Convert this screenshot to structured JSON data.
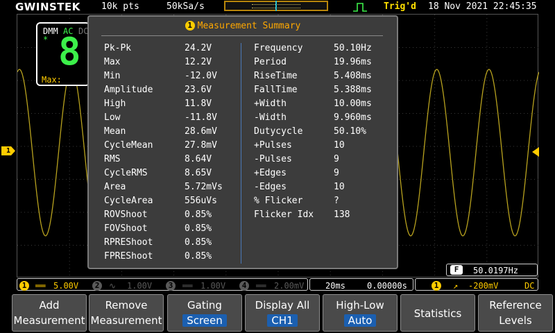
{
  "topbar": {
    "brand": "GWINSTEK",
    "memory_depth": "10k pts",
    "sample_rate": "50kSa/s",
    "trigger_status": "Trig'd",
    "datetime": "18 Nov 2021 22:45:35"
  },
  "dmm": {
    "label": "DMM",
    "mode": "AC",
    "mode_off": "DC",
    "marker": "*",
    "value": "8.",
    "max_label": "Max:",
    "max_value": "--"
  },
  "summary": {
    "title": "Measurement Summary",
    "channel": "1",
    "left": [
      {
        "name": "Pk-Pk",
        "value": "24.2V"
      },
      {
        "name": "Max",
        "value": "12.2V"
      },
      {
        "name": "Min",
        "value": "-12.0V"
      },
      {
        "name": "Amplitude",
        "value": "23.6V"
      },
      {
        "name": "High",
        "value": "11.8V"
      },
      {
        "name": "Low",
        "value": "-11.8V"
      },
      {
        "name": "Mean",
        "value": "28.6mV"
      },
      {
        "name": "CycleMean",
        "value": "27.8mV"
      },
      {
        "name": "RMS",
        "value": "8.64V"
      },
      {
        "name": "CycleRMS",
        "value": "8.65V"
      },
      {
        "name": "Area",
        "value": "5.72mVs"
      },
      {
        "name": "CycleArea",
        "value": "556uVs"
      },
      {
        "name": "ROVShoot",
        "value": "0.85%"
      },
      {
        "name": "FOVShoot",
        "value": "0.85%"
      },
      {
        "name": "RPREShoot",
        "value": "0.85%"
      },
      {
        "name": "FPREShoot",
        "value": "0.85%"
      }
    ],
    "right": [
      {
        "name": "Frequency",
        "value": "50.10Hz"
      },
      {
        "name": "Period",
        "value": "19.96ms"
      },
      {
        "name": "RiseTime",
        "value": "5.408ms"
      },
      {
        "name": "FallTime",
        "value": "5.388ms"
      },
      {
        "name": "+Width",
        "value": "10.00ms"
      },
      {
        "name": "-Width",
        "value": "9.960ms"
      },
      {
        "name": "Dutycycle",
        "value": "50.10%"
      },
      {
        "name": "+Pulses",
        "value": "10"
      },
      {
        "name": "-Pulses",
        "value": "9"
      },
      {
        "name": "+Edges",
        "value": "9"
      },
      {
        "name": "-Edges",
        "value": "10"
      },
      {
        "name": "% Flicker",
        "value": "?"
      },
      {
        "name": "Flicker Idx",
        "value": "138"
      }
    ]
  },
  "channels": {
    "ch1": {
      "num": "1",
      "coupling": "══",
      "scale": "5.00V",
      "color": "#ffcc00"
    },
    "ch2": {
      "num": "2",
      "coupling": "∿",
      "scale": "1.00V",
      "color": "#5a5a5a"
    },
    "ch3": {
      "num": "3",
      "coupling": "══",
      "scale": "1.00V",
      "color": "#5a5a5a"
    },
    "ch4": {
      "num": "4",
      "coupling": "══",
      "scale": "2.00mV",
      "color": "#5a5a5a"
    }
  },
  "timebase": {
    "scale": "20ms",
    "position": "0.00000s"
  },
  "trigger": {
    "source": "1",
    "slope": "↗",
    "level": "-200mV",
    "coupling": "DC"
  },
  "frequency_counter": {
    "label": "F",
    "value": "50.0197Hz"
  },
  "ch1_marker": "1",
  "softkeys": [
    {
      "line1": "Add",
      "line2": "Measurement"
    },
    {
      "line1": "Remove",
      "line2": "Measurement"
    },
    {
      "line1": "Gating",
      "value": "Screen"
    },
    {
      "line1": "Display All",
      "value": "CH1"
    },
    {
      "line1": "High-Low",
      "value": "Auto"
    },
    {
      "single": "Statistics"
    },
    {
      "line1": "Reference",
      "line2": "Levels"
    }
  ],
  "colors": {
    "trace": "#b8a21e",
    "accent_yellow": "#ffcc00",
    "dmm_green": "#3cf04a",
    "value_blue": "#1b5fb0",
    "title_orange": "#ffa800"
  }
}
